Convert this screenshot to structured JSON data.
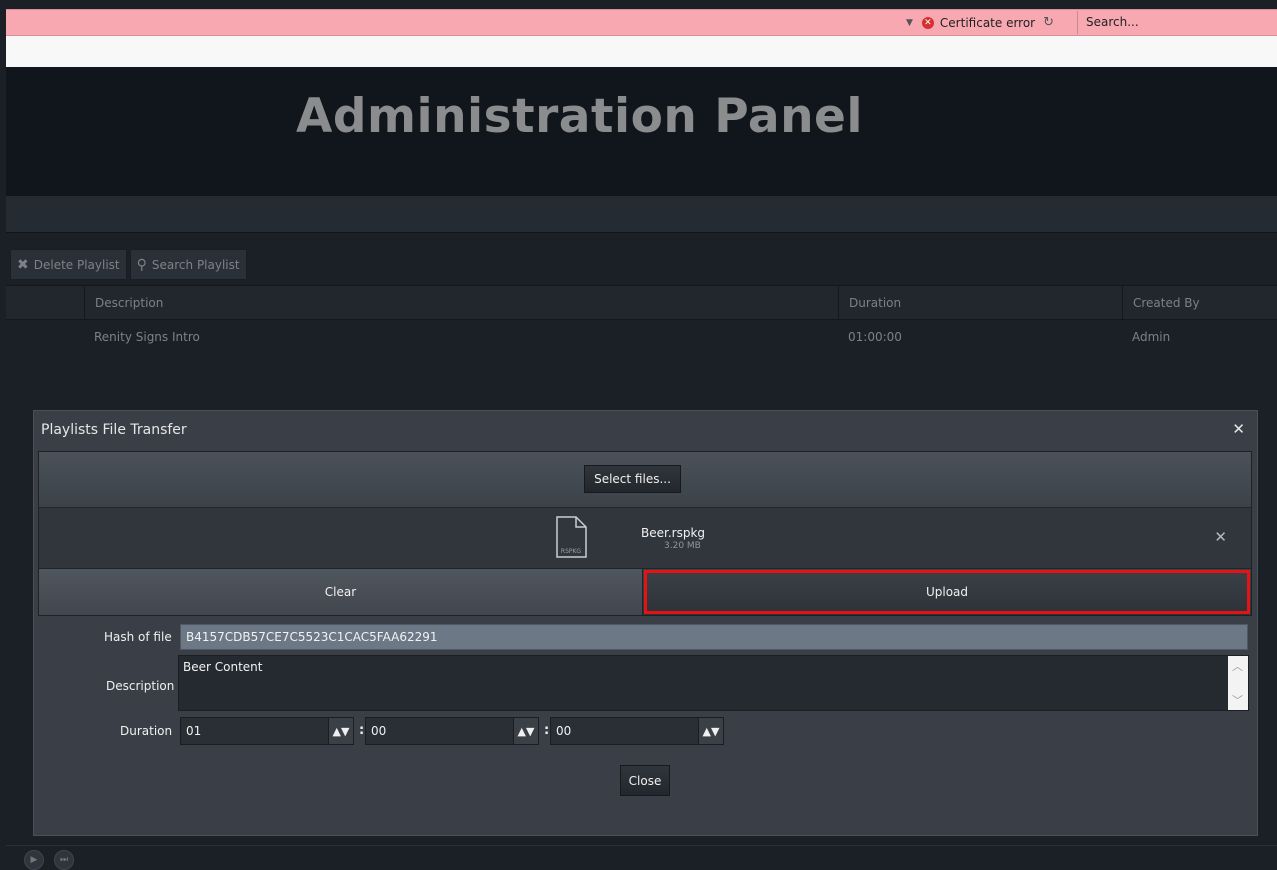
{
  "browser": {
    "certificate_error": "Certificate error",
    "search_placeholder": "Search..."
  },
  "header": {
    "title": "Administration Panel"
  },
  "toolbar": {
    "delete_label": "Delete Playlist",
    "search_label": "Search Playlist"
  },
  "grid": {
    "columns": [
      "Description",
      "Duration",
      "Created By"
    ],
    "rows": [
      {
        "description": "Renity Signs Intro",
        "duration": "01:00:00",
        "created_by": "Admin"
      }
    ]
  },
  "dialog": {
    "title": "Playlists File Transfer",
    "select_files_label": "Select files...",
    "file": {
      "name": "Beer.rspkg",
      "size": "3.20 MB",
      "icon_text": "RSPKG"
    },
    "clear_label": "Clear",
    "upload_label": "Upload",
    "hash_label": "Hash of file",
    "hash_value": "B4157CDB57CE7C5523C1CAC5FAA62291",
    "description_label": "Description",
    "description_value": "Beer Content",
    "duration_label": "Duration",
    "duration_hours": "01",
    "duration_minutes": "00",
    "duration_seconds": "00",
    "close_label": "Close"
  },
  "colors": {
    "highlight": "#e41414",
    "browser_bar": "#f7a8b1",
    "header_bg": "#11161c"
  }
}
